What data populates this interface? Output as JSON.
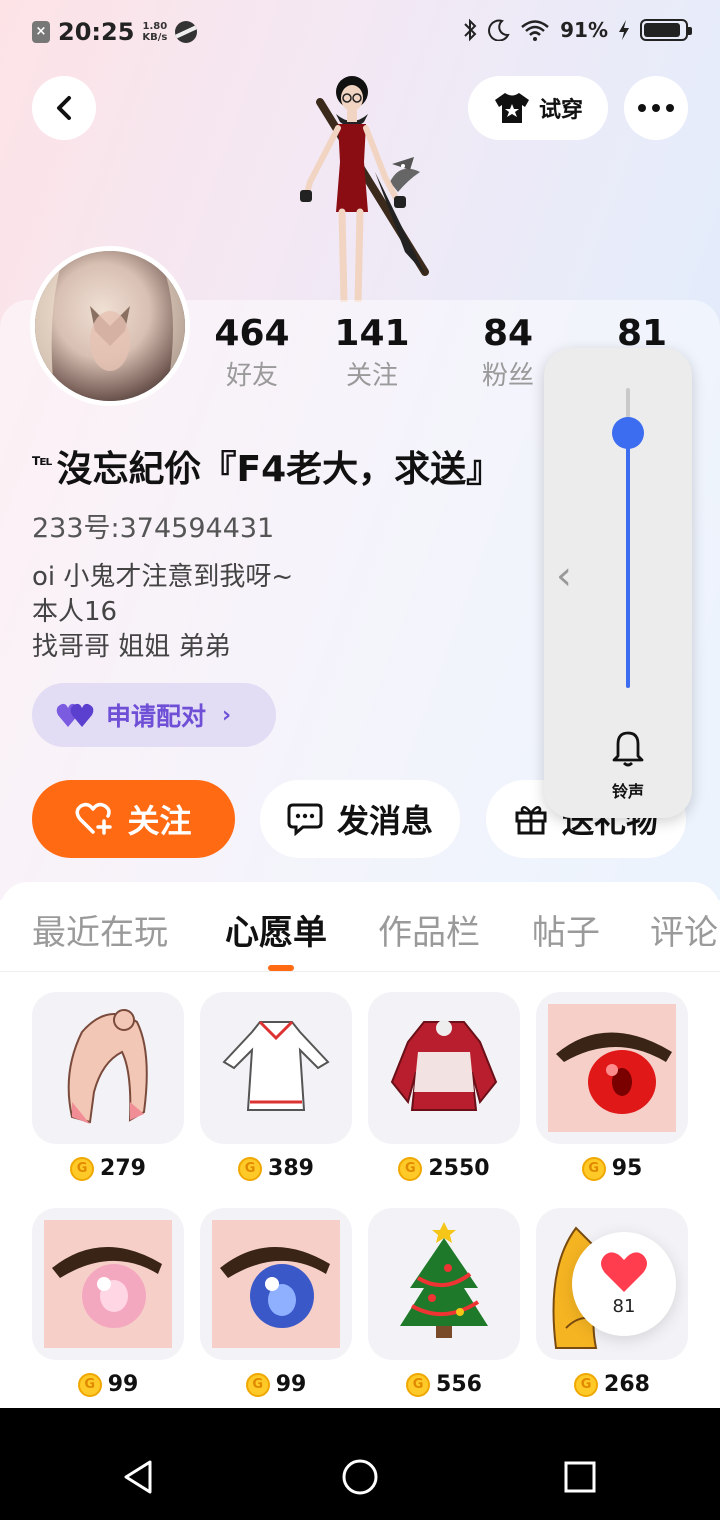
{
  "status_bar": {
    "time": "20:25",
    "net_speed_value": "1.80",
    "net_speed_unit": "KB/s",
    "battery": "91%"
  },
  "header": {
    "try_on_label": "试穿",
    "icons": [
      "back-arrow-icon",
      "shirt-star-icon",
      "more-icon"
    ]
  },
  "profile": {
    "stats": [
      {
        "value": "464",
        "label": "好友"
      },
      {
        "value": "141",
        "label": "关注"
      },
      {
        "value": "84",
        "label": "粉丝"
      },
      {
        "value": "81",
        "label": ""
      }
    ],
    "nickname_prefix": "℡",
    "nickname": "沒忘紀伱『F4老大，求送』",
    "uid": "233号:374594431",
    "bio_lines": [
      "oi  小鬼才注意到我呀~",
      "本人16",
      "找哥哥 姐姐 弟弟"
    ],
    "pair_label": "申请配对"
  },
  "actions": {
    "follow": "关注",
    "message": "发消息",
    "gift": "送礼物"
  },
  "tabs": [
    "最近在玩",
    "心愿单",
    "作品栏",
    "帖子",
    "评论"
  ],
  "active_tab": "心愿单",
  "wishlist": [
    {
      "item": "hair",
      "price": "279"
    },
    {
      "item": "dress",
      "price": "389"
    },
    {
      "item": "red-outfit",
      "price": "2550"
    },
    {
      "item": "red-eye",
      "price": "95"
    },
    {
      "item": "pink-eye",
      "price": "99"
    },
    {
      "item": "blue-eye",
      "price": "99"
    },
    {
      "item": "christmas-tree",
      "price": "556"
    },
    {
      "item": "yellow-hair",
      "price": "268"
    }
  ],
  "coin_symbol": "G",
  "volume_panel": {
    "label": "铃声",
    "level": 0.85
  },
  "like_bubble": {
    "count": "81"
  },
  "colors": {
    "accent": "#ff6a13",
    "pair": "#6e4fd6",
    "volume": "#3c6cf0",
    "coin": "#ffc928"
  }
}
